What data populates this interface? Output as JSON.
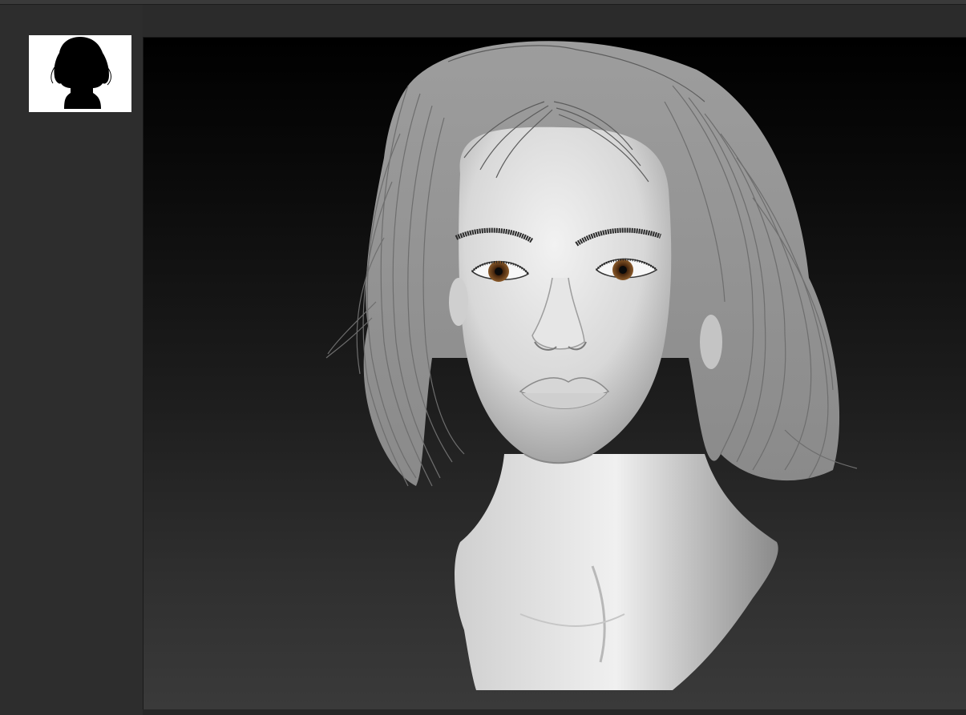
{
  "app": {
    "canvas_background": "#000000",
    "shelf_color": "#2d2d2d",
    "thumbnail_background": "#ffffff"
  },
  "icons": {
    "thumbnail": "head-silhouette-icon"
  }
}
